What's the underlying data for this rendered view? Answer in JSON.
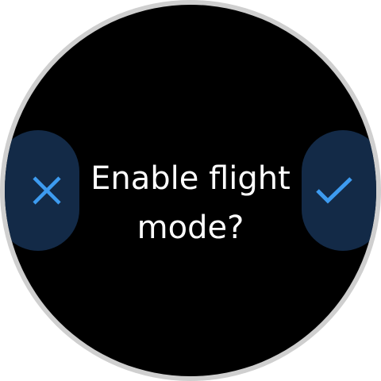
{
  "dialog": {
    "prompt": "Enable flight mode?"
  },
  "buttons": {
    "cancel_icon": "close-icon",
    "confirm_icon": "check-icon"
  },
  "colors": {
    "background": "#000000",
    "button_bg": "#132a47",
    "icon_accent": "#3d9bf0",
    "bezel": "#cfcfcf",
    "text": "#ffffff"
  }
}
